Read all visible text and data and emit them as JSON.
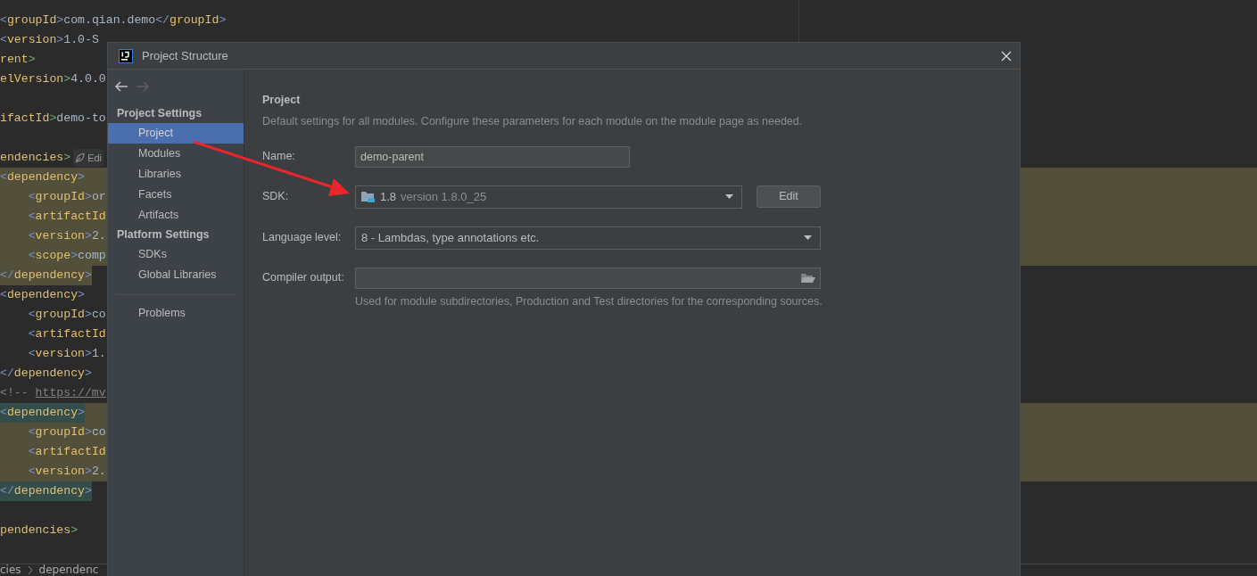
{
  "editor": {
    "lines": [
      {
        "parts": [
          {
            "t": "<",
            "kind": "bracket"
          },
          {
            "t": "groupId",
            "kind": "tag"
          },
          {
            "t": ">",
            "kind": "bracket"
          },
          {
            "t": "com.qian.demo",
            "kind": "text"
          },
          {
            "t": "</",
            "kind": "bracket"
          },
          {
            "t": "groupId",
            "kind": "tag"
          },
          {
            "t": ">",
            "kind": "bracket"
          }
        ]
      },
      {
        "parts": [
          {
            "t": "<",
            "kind": "bracket"
          },
          {
            "t": "version",
            "kind": "tag"
          },
          {
            "t": ">",
            "kind": "bracket"
          },
          {
            "t": "1.0-S",
            "kind": "text"
          }
        ]
      },
      {
        "parts": [
          {
            "t": "rent",
            "kind": "tag"
          },
          {
            "t": ">",
            "kind": "closer"
          }
        ]
      },
      {
        "parts": [
          {
            "t": "elVersion",
            "kind": "tag"
          },
          {
            "t": ">",
            "kind": "closer"
          },
          {
            "t": "4.0.0",
            "kind": "text"
          }
        ],
        "blank_after": true
      },
      {
        "parts": [
          {
            "t": "ifactId",
            "kind": "tag"
          },
          {
            "t": ">",
            "kind": "closer"
          },
          {
            "t": "demo-to",
            "kind": "text"
          }
        ],
        "blank_after": true
      },
      {
        "parts": [
          {
            "t": "endencies",
            "kind": "tag"
          },
          {
            "t": ">",
            "kind": "closer"
          }
        ],
        "hint": "Edi"
      },
      {
        "parts": [
          {
            "t": "<",
            "kind": "bracket"
          },
          {
            "t": "dependency",
            "kind": "tag"
          },
          {
            "t": ">",
            "kind": "bracket"
          }
        ],
        "band": true
      },
      {
        "indent": true,
        "parts": [
          {
            "t": "<",
            "kind": "bracket"
          },
          {
            "t": "groupId",
            "kind": "tag"
          },
          {
            "t": ">",
            "kind": "bracket"
          },
          {
            "t": "or",
            "kind": "text"
          }
        ],
        "band": true
      },
      {
        "indent": true,
        "parts": [
          {
            "t": "<",
            "kind": "bracket"
          },
          {
            "t": "artifactId",
            "kind": "tag"
          }
        ],
        "band": true
      },
      {
        "indent": true,
        "parts": [
          {
            "t": "<",
            "kind": "bracket"
          },
          {
            "t": "version",
            "kind": "tag"
          },
          {
            "t": ">",
            "kind": "bracket"
          },
          {
            "t": "2.",
            "kind": "text"
          }
        ],
        "band": true
      },
      {
        "indent": true,
        "parts": [
          {
            "t": "<",
            "kind": "bracket"
          },
          {
            "t": "scope",
            "kind": "tag"
          },
          {
            "t": ">",
            "kind": "bracket"
          },
          {
            "t": "comp",
            "kind": "text"
          }
        ],
        "band": true
      },
      {
        "parts": [
          {
            "t": "</",
            "kind": "bracket"
          },
          {
            "t": "dependency",
            "kind": "tag"
          },
          {
            "t": ">",
            "kind": "bracket"
          }
        ],
        "color": "#52503a"
      },
      {
        "parts": [
          {
            "t": "<",
            "kind": "bracket"
          },
          {
            "t": "dependency",
            "kind": "tag"
          },
          {
            "t": ">",
            "kind": "bracket"
          }
        ]
      },
      {
        "indent": true,
        "parts": [
          {
            "t": "<",
            "kind": "bracket"
          },
          {
            "t": "groupId",
            "kind": "tag"
          },
          {
            "t": ">",
            "kind": "bracket"
          },
          {
            "t": "co",
            "kind": "text"
          }
        ]
      },
      {
        "indent": true,
        "parts": [
          {
            "t": "<",
            "kind": "bracket"
          },
          {
            "t": "artifactId",
            "kind": "tag"
          }
        ]
      },
      {
        "indent": true,
        "parts": [
          {
            "t": "<",
            "kind": "bracket"
          },
          {
            "t": "version",
            "kind": "tag"
          },
          {
            "t": ">",
            "kind": "bracket"
          },
          {
            "t": "1.",
            "kind": "text"
          }
        ]
      },
      {
        "parts": [
          {
            "t": "</",
            "kind": "bracket"
          },
          {
            "t": "dependency",
            "kind": "tag"
          },
          {
            "t": ">",
            "kind": "bracket"
          }
        ]
      },
      {
        "parts": [
          {
            "t": "<!--",
            "kind": "comment"
          },
          {
            "t": "https://mv",
            "kind": "url"
          }
        ]
      },
      {
        "parts": [
          {
            "t": "<",
            "kind": "bracket"
          },
          {
            "t": "dependency",
            "kind": "tag"
          },
          {
            "t": ">",
            "kind": "bracket"
          }
        ],
        "band": true,
        "color": "#344d4b"
      },
      {
        "indent": true,
        "parts": [
          {
            "t": "<",
            "kind": "bracket"
          },
          {
            "t": "groupId",
            "kind": "tag"
          },
          {
            "t": ">",
            "kind": "bracket"
          },
          {
            "t": "co",
            "kind": "text"
          }
        ],
        "band": true
      },
      {
        "indent": true,
        "parts": [
          {
            "t": "<",
            "kind": "bracket"
          },
          {
            "t": "artifactId",
            "kind": "tag"
          }
        ],
        "band": true
      },
      {
        "indent": true,
        "parts": [
          {
            "t": "<",
            "kind": "bracket"
          },
          {
            "t": "version",
            "kind": "tag"
          },
          {
            "t": ">",
            "kind": "bracket"
          },
          {
            "t": "2.",
            "kind": "text"
          }
        ],
        "band": true
      },
      {
        "parts": [
          {
            "t": "</",
            "kind": "bracket"
          },
          {
            "t": "dependency",
            "kind": "tag"
          },
          {
            "t": ">",
            "kind": "bracket"
          }
        ],
        "color": "#344d4b",
        "blank_after": true
      },
      {
        "parts": [
          {
            "t": "pendencies",
            "kind": "tag"
          },
          {
            "t": ">",
            "kind": "closer"
          }
        ]
      }
    ],
    "breadcrumbs": [
      "cies",
      "dependenc"
    ]
  },
  "dialog": {
    "title": "Project Structure",
    "nav": {
      "back_enabled": true,
      "forward_enabled": false
    },
    "sidebar": {
      "sections": [
        {
          "heading": "Project Settings",
          "items": [
            {
              "label": "Project",
              "selected": true
            },
            {
              "label": "Modules",
              "selected": false
            },
            {
              "label": "Libraries",
              "selected": false
            },
            {
              "label": "Facets",
              "selected": false
            },
            {
              "label": "Artifacts",
              "selected": false
            }
          ]
        },
        {
          "heading": "Platform Settings",
          "items": [
            {
              "label": "SDKs",
              "selected": false
            },
            {
              "label": "Global Libraries",
              "selected": false
            }
          ]
        },
        {
          "items": [
            {
              "label": "Problems",
              "selected": false
            }
          ]
        }
      ]
    },
    "panel": {
      "heading": "Project",
      "description": "Default settings for all modules. Configure these parameters for each module on the module page as needed.",
      "fields": [
        {
          "kind": "text",
          "label": "Name:",
          "value": "demo-parent"
        },
        {
          "kind": "sdk",
          "label": "SDK:",
          "value": "1.8",
          "detail": "version 1.8.0_25",
          "button": "Edit"
        },
        {
          "kind": "combo",
          "label": "Language level:",
          "value": "8 - Lambdas, type annotations etc."
        },
        {
          "kind": "path",
          "label": "Compiler output:",
          "hint": "Used for module subdirectories, Production and Test directories for the corresponding sources."
        }
      ]
    }
  }
}
